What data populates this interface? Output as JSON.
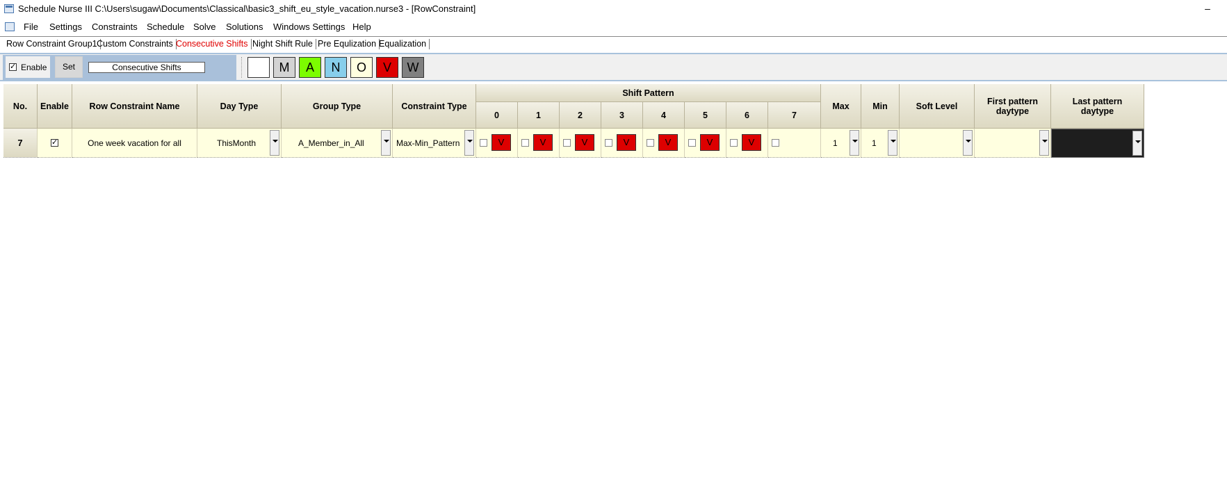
{
  "window": {
    "title": "Schedule Nurse III  C:\\Users\\sugaw\\Documents\\Classical\\basic3_shift_eu_style_vacation.nurse3 - [RowConstraint]",
    "minimize_symbol": "–"
  },
  "menu": [
    "File",
    "Settings",
    "Constraints",
    "Schedule",
    "Solve",
    "Solutions",
    "Windows Settings",
    "Help"
  ],
  "tabs": [
    "Row Constraint Group1",
    "Custom Constraints",
    "Consecutive Shifts",
    "Night Shift Rule",
    "Pre Equlization",
    "Equalization"
  ],
  "active_tab": "Consecutive Shifts",
  "toolbar": {
    "enable_label": "Enable",
    "enable_checked": true,
    "set_label": "Set",
    "constraint_name": "Consecutive Shifts",
    "shift_buttons": [
      {
        "label": "",
        "color": "#ffffff",
        "text_color": "#000000"
      },
      {
        "label": "M",
        "color": "#d3d3d3",
        "text_color": "#000000"
      },
      {
        "label": "A",
        "color": "#7cfc00",
        "text_color": "#000000"
      },
      {
        "label": "N",
        "color": "#87ceeb",
        "text_color": "#000000"
      },
      {
        "label": "O",
        "color": "#ffffe0",
        "text_color": "#000000"
      },
      {
        "label": "V",
        "color": "#dd0000",
        "text_color": "#000000"
      },
      {
        "label": "W",
        "color": "#808080",
        "text_color": "#000000"
      }
    ]
  },
  "grid": {
    "headers": {
      "no": "No.",
      "enable": "Enable",
      "name": "Row Constraint Name",
      "day_type": "Day Type",
      "group_type": "Group Type",
      "constraint_type": "Constraint Type",
      "shift_pattern": "Shift Pattern",
      "pattern_cols": [
        "0",
        "1",
        "2",
        "3",
        "4",
        "5",
        "6",
        "7"
      ],
      "max": "Max",
      "min": "Min",
      "soft_level": "Soft Level",
      "first_pattern": "First pattern daytype",
      "last_pattern": "Last pattern daytype"
    },
    "rows": [
      {
        "no": "7",
        "enabled": true,
        "name": "One week vacation for all",
        "day_type": "ThisMonth",
        "group_type": "A_Member_in_All",
        "constraint_type": "Max-Min_Pattern",
        "pattern": [
          "V",
          "V",
          "V",
          "V",
          "V",
          "V",
          "V",
          ""
        ],
        "max": "1",
        "min": "1",
        "soft_level": "",
        "first_pattern": "",
        "last_pattern": ""
      }
    ]
  },
  "colors": {
    "header_bg": "#e6e3d0",
    "cell_bg": "#ffffe0",
    "vacation_red": "#dd0000",
    "active_tab": "#e00000",
    "toolbar_blue": "#a9c0da",
    "last_pattern_cell": "#1e1e1e"
  }
}
